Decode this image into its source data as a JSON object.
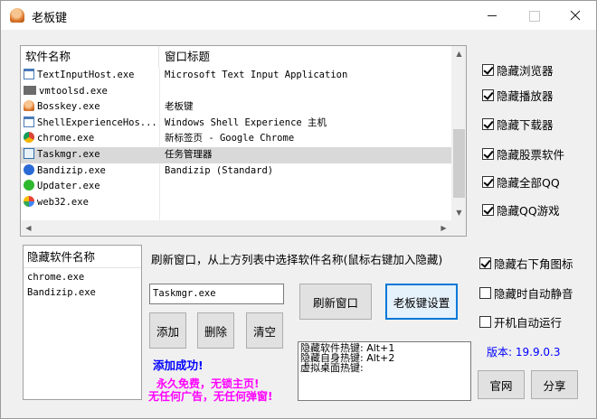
{
  "window": {
    "title": "老板键"
  },
  "process_table": {
    "columns": [
      "软件名称",
      "窗口标题"
    ],
    "rows": [
      {
        "name": "TextInputHost.exe",
        "title": "Microsoft Text Input Application",
        "icon": "app-window-icon"
      },
      {
        "name": "vmtoolsd.exe",
        "title": "",
        "icon": "vm-icon"
      },
      {
        "name": "Bosskey.exe",
        "title": "老板键",
        "icon": "bosskey-icon"
      },
      {
        "name": "ShellExperienceHos...",
        "title": "Windows Shell Experience 主机",
        "icon": "app-window-icon"
      },
      {
        "name": "chrome.exe",
        "title": "新标签页 - Google Chrome",
        "icon": "chrome-icon"
      },
      {
        "name": "Taskmgr.exe",
        "title": "任务管理器",
        "icon": "task-manager-icon",
        "selected": true
      },
      {
        "name": "Bandizip.exe",
        "title": "Bandizip (Standard)",
        "icon": "bandizip-icon"
      },
      {
        "name": "Updater.exe",
        "title": "",
        "icon": "updater-icon"
      },
      {
        "name": "web32.exe",
        "title": "",
        "icon": "web-icon"
      }
    ]
  },
  "options_right": [
    {
      "label": "隐藏浏览器",
      "checked": true
    },
    {
      "label": "隐藏播放器",
      "checked": true
    },
    {
      "label": "隐藏下载器",
      "checked": true
    },
    {
      "label": "隐藏股票软件",
      "checked": true
    },
    {
      "label": "隐藏全部QQ",
      "checked": true
    },
    {
      "label": "隐藏QQ游戏",
      "checked": true
    }
  ],
  "options_lower": [
    {
      "label": "隐藏右下角图标",
      "checked": true
    },
    {
      "label": "隐藏时自动静音",
      "checked": false
    },
    {
      "label": "开机自动运行",
      "checked": false
    }
  ],
  "hidden_list": {
    "header": "隐藏软件名称",
    "items": [
      "chrome.exe",
      "Bandizip.exe"
    ]
  },
  "hint": "刷新窗口，从上方列表中选择软件名称(鼠标右键加入隐藏)",
  "name_input": {
    "value": "Taskmgr.exe"
  },
  "buttons": {
    "refresh": "刷新窗口",
    "settings": "老板键设置",
    "add": "添加",
    "delete": "删除",
    "clear": "清空",
    "website": "官网",
    "share": "分享"
  },
  "status": "添加成功!",
  "promo": {
    "line1": "永久免费，无锁主页!",
    "line2": "无任何广告，无任何弹窗!"
  },
  "hotkeys": [
    "隐藏软件热键: Alt+1",
    "隐藏自身热键: Alt+2",
    "虚拟桌面热键:"
  ],
  "version": "版本: 19.9.0.3",
  "colors": {
    "link_blue": "#0000ff",
    "promo_magenta": "#ff00ff",
    "accent": "#0078d7"
  }
}
